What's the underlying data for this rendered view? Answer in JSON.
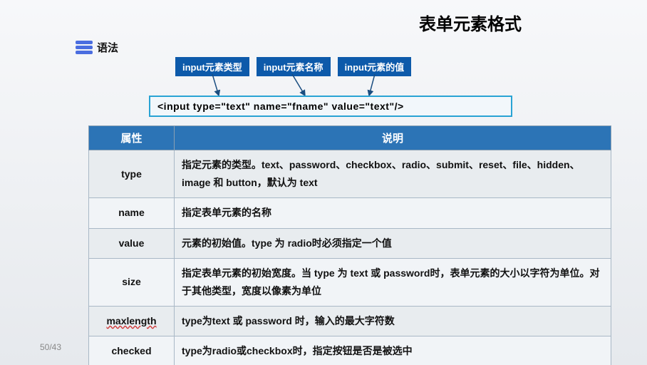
{
  "title": "表单元素格式",
  "syntax_label": "语法",
  "callouts": {
    "type": "input元素类型",
    "name": "input元素名称",
    "value": "input元素的值"
  },
  "code_example": "<input  type=\"text\"  name=\"fname\" value=\"text\"/>",
  "table": {
    "headers": {
      "attr": "属性",
      "desc": "说明"
    },
    "rows": [
      {
        "attr": "type",
        "desc": "指定元素的类型。text、password、checkbox、radio、submit、reset、file、hidden、image 和 button，默认为 text"
      },
      {
        "attr": "name",
        "desc": "指定表单元素的名称"
      },
      {
        "attr": "value",
        "desc": "元素的初始值。type 为 radio时必须指定一个值"
      },
      {
        "attr": "size",
        "desc": "指定表单元素的初始宽度。当 type 为 text 或 password时，表单元素的大小以字符为单位。对于其他类型，宽度以像素为单位"
      },
      {
        "attr": "maxlength",
        "desc": "type为text 或 password 时，输入的最大字符数"
      },
      {
        "attr": "checked",
        "desc": "type为radio或checkbox时，指定按钮是否是被选中"
      }
    ]
  },
  "pager": "50/43"
}
